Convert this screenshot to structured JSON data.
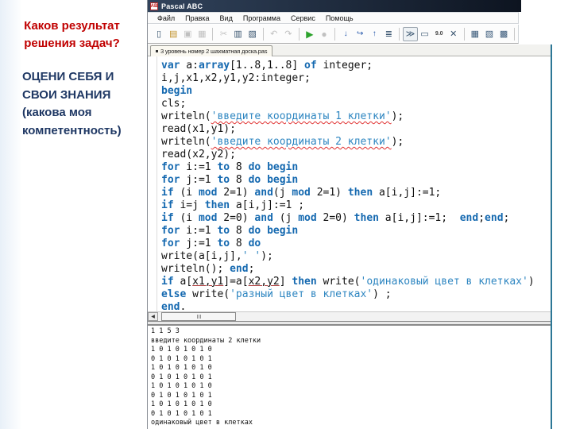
{
  "colors": {
    "question_red": "#c00000",
    "statement_navy": "#1f3864",
    "keyword_blue": "#1569b0",
    "string_blue": "#2e86c1",
    "window_border_teal": "#2d7796",
    "run_green": "#2da32d",
    "stop_red": "#c0392b"
  },
  "slide": {
    "question": {
      "lines": [
        "Каков результат",
        "решения задач?"
      ]
    },
    "statement": {
      "lines": [
        "ОЦЕНИ СЕБЯ И",
        "СВОИ ЗНАНИЯ",
        "(какова моя",
        "компетентность)"
      ]
    }
  },
  "app": {
    "title": "Pascal ABC",
    "logo_text": "AB",
    "menu": [
      "Файл",
      "Правка",
      "Вид",
      "Программа",
      "Сервис",
      "Помощь"
    ],
    "toolbar": [
      {
        "name": "new-file",
        "glyph": "▯",
        "cls": ""
      },
      {
        "name": "open-file",
        "glyph": "▤",
        "cls": "folder"
      },
      {
        "name": "save-file",
        "glyph": "▣",
        "cls": "disabled"
      },
      {
        "name": "save-all",
        "glyph": "▦",
        "cls": "disabled",
        "sep": true
      },
      {
        "name": "cut",
        "glyph": "✂",
        "cls": "disabled"
      },
      {
        "name": "copy",
        "glyph": "▥",
        "cls": ""
      },
      {
        "name": "paste",
        "glyph": "▧",
        "cls": "",
        "sep": true
      },
      {
        "name": "undo",
        "glyph": "↶",
        "cls": "disabled"
      },
      {
        "name": "redo",
        "glyph": "↷",
        "cls": "disabled",
        "sep": true
      },
      {
        "name": "run",
        "glyph": "▶",
        "cls": "run"
      },
      {
        "name": "stop",
        "glyph": "●",
        "cls": "stop disabled",
        "sep": true
      },
      {
        "name": "step-into",
        "glyph": "↓",
        "cls": "step"
      },
      {
        "name": "step-over",
        "glyph": "↪",
        "cls": "step"
      },
      {
        "name": "step-out",
        "glyph": "↑",
        "cls": "step"
      },
      {
        "name": "add-watch",
        "glyph": "≣",
        "cls": "",
        "sep": true
      },
      {
        "name": "toggle-output-window",
        "glyph": "≫",
        "cls": "pressed"
      },
      {
        "name": "new-output-page",
        "glyph": "▭",
        "cls": ""
      },
      {
        "name": "format-numbers",
        "glyph": "9.0",
        "cls": "small"
      },
      {
        "name": "clear-output",
        "glyph": "✕",
        "cls": "",
        "sep": true
      },
      {
        "name": "window-layout-1",
        "glyph": "▦",
        "cls": "winicon"
      },
      {
        "name": "window-layout-2",
        "glyph": "▧",
        "cls": "winicon"
      },
      {
        "name": "window-layout-3",
        "glyph": "▩",
        "cls": "winicon",
        "sep": true
      }
    ],
    "tab": {
      "label": "3 уровень номер 2 шахматная доска.pas"
    },
    "editor": {
      "lines": [
        [
          [
            "k",
            "var"
          ],
          [
            "n",
            " a:"
          ],
          [
            "k",
            "array"
          ],
          [
            "n",
            "[1..8,1..8] "
          ],
          [
            "k",
            "of"
          ],
          [
            "n",
            " integer;"
          ]
        ],
        [
          [
            "n",
            "i,j,x1,x2,y1,y2:integer;"
          ]
        ],
        [
          [
            "k",
            "begin"
          ]
        ],
        [
          [
            "n",
            "cls;"
          ]
        ],
        [
          [
            "n",
            "writeln("
          ],
          [
            "r",
            "'введите координаты 1 клетки'"
          ],
          [
            "n",
            ");"
          ]
        ],
        [
          [
            "n",
            "read(x1,y1);"
          ]
        ],
        [
          [
            "n",
            "writeln("
          ],
          [
            "r",
            "'введите координаты 2 клетки'"
          ],
          [
            "n",
            ");"
          ]
        ],
        [
          [
            "n",
            "read(x2,y2);"
          ]
        ],
        [
          [
            "k",
            "for"
          ],
          [
            "n",
            " i:=1 "
          ],
          [
            "k",
            "to"
          ],
          [
            "n",
            " 8 "
          ],
          [
            "k",
            "do"
          ],
          [
            "n",
            " "
          ],
          [
            "k",
            "begin"
          ]
        ],
        [
          [
            "k",
            "for"
          ],
          [
            "n",
            " j:=1 "
          ],
          [
            "k",
            "to"
          ],
          [
            "n",
            " 8 "
          ],
          [
            "k",
            "do"
          ],
          [
            "n",
            " "
          ],
          [
            "k",
            "begin"
          ]
        ],
        [
          [
            "k",
            "if"
          ],
          [
            "n",
            " (i "
          ],
          [
            "k",
            "mod"
          ],
          [
            "n",
            " 2=1) "
          ],
          [
            "k",
            "and"
          ],
          [
            "n",
            "(j "
          ],
          [
            "k",
            "mod"
          ],
          [
            "n",
            " 2=1) "
          ],
          [
            "k",
            "then"
          ],
          [
            "n",
            " a[i,j]:=1;"
          ]
        ],
        [
          [
            "k",
            "if"
          ],
          [
            "n",
            " i=j "
          ],
          [
            "k",
            "then"
          ],
          [
            "n",
            " a[i,j]:=1 ;"
          ]
        ],
        [
          [
            "k",
            "if"
          ],
          [
            "n",
            " (i "
          ],
          [
            "k",
            "mod"
          ],
          [
            "n",
            " 2=0) "
          ],
          [
            "k",
            "and"
          ],
          [
            "n",
            " (j "
          ],
          [
            "k",
            "mod"
          ],
          [
            "n",
            " 2=0) "
          ],
          [
            "k",
            "then"
          ],
          [
            "n",
            " a[i,j]:=1;  "
          ],
          [
            "k",
            "end"
          ],
          [
            "n",
            ";"
          ],
          [
            "k",
            "end"
          ],
          [
            "n",
            ";"
          ]
        ],
        [
          [
            "k",
            "for"
          ],
          [
            "n",
            " i:=1 "
          ],
          [
            "k",
            "to"
          ],
          [
            "n",
            " 8 "
          ],
          [
            "k",
            "do"
          ],
          [
            "n",
            " "
          ],
          [
            "k",
            "begin"
          ]
        ],
        [
          [
            "k",
            "for"
          ],
          [
            "n",
            " j:=1 "
          ],
          [
            "k",
            "to"
          ],
          [
            "n",
            " 8 "
          ],
          [
            "k",
            "do"
          ]
        ],
        [
          [
            "n",
            "write(a[i,j],"
          ],
          [
            "b",
            "' '"
          ],
          [
            "n",
            ");"
          ]
        ],
        [
          [
            "n",
            "writeln(); "
          ],
          [
            "k",
            "end"
          ],
          [
            "n",
            ";"
          ]
        ],
        [
          [
            "k",
            "if"
          ],
          [
            "n",
            " a["
          ],
          [
            "u",
            "x1,y1"
          ],
          [
            "n",
            "]=a["
          ],
          [
            "u",
            "x2,y2"
          ],
          [
            "n",
            "] "
          ],
          [
            "k",
            "then"
          ],
          [
            "n",
            " write("
          ],
          [
            "b",
            "'одинаковый цвет в клетках'"
          ],
          [
            "n",
            ")"
          ]
        ],
        [
          [
            "k",
            "else"
          ],
          [
            "n",
            " write("
          ],
          [
            "b",
            "'разный цвет в клетках'"
          ],
          [
            "n",
            ") ;"
          ]
        ],
        [
          [
            "k",
            "end"
          ],
          [
            "n",
            "."
          ]
        ]
      ]
    },
    "console": {
      "lines": [
        "1 1 5 3",
        "введите координаты 2 клетки",
        "1 0 1 0 1 0 1 0",
        "0 1 0 1 0 1 0 1",
        "1 0 1 0 1 0 1 0",
        "0 1 0 1 0 1 0 1",
        "1 0 1 0 1 0 1 0",
        "0 1 0 1 0 1 0 1",
        "1 0 1 0 1 0 1 0",
        "0 1 0 1 0 1 0 1",
        "одинаковый цвет в клетках"
      ]
    }
  }
}
